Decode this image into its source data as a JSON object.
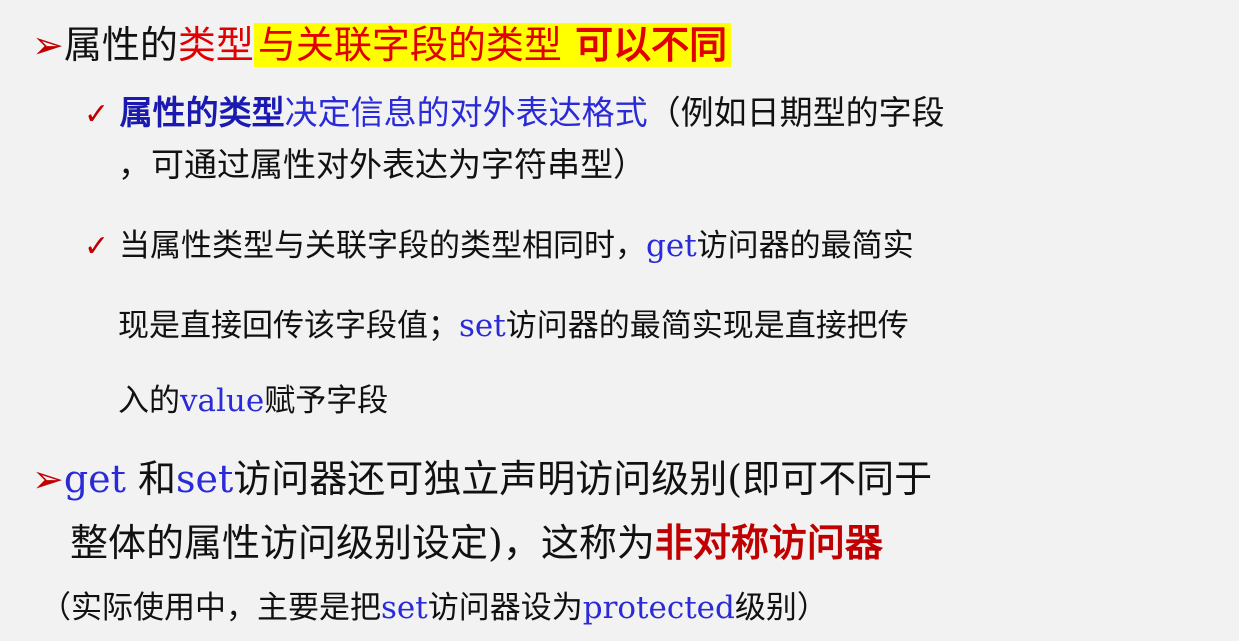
{
  "bullet1": {
    "a": "属性的",
    "b": "类型",
    "c": "与关联字段的类型",
    "d": " 可以不同"
  },
  "sub1": {
    "a": "属性的类型",
    "b": "决定信息的对外表达格式",
    "c": "（例如日期型的字段",
    "d": "，可通过属性对外表达为字符串型）"
  },
  "sub2": {
    "a": "当属性类型与关联字段的类型相同时，",
    "get": "get",
    "b": "访问器的最简实",
    "c": "现是直接回传该字段值；",
    "set": "set",
    "d": "访问器的最简实现是直接把传",
    "e": "入的",
    "value": "value",
    "f": "赋予字段"
  },
  "bullet2": {
    "get": "get",
    "a": " 和",
    "set": "set",
    "b": "访问器还可独立声明访问级别(即可不同于",
    "c": "整体的属性访问级别设定)，这称为",
    "d": "非对称访问器"
  },
  "note": {
    "a": "（实际使用中，主要是把",
    "set": "set",
    "b": "访问器设为",
    "protected": "protected",
    "c": "级别）"
  },
  "colors": {
    "red": "#e00000",
    "blue": "#2a2ad8",
    "highlight": "#ffff00"
  },
  "icons": {
    "main_bullet": "arrowhead-bullet-icon",
    "sub_bullet": "checkmark-bullet-icon"
  }
}
